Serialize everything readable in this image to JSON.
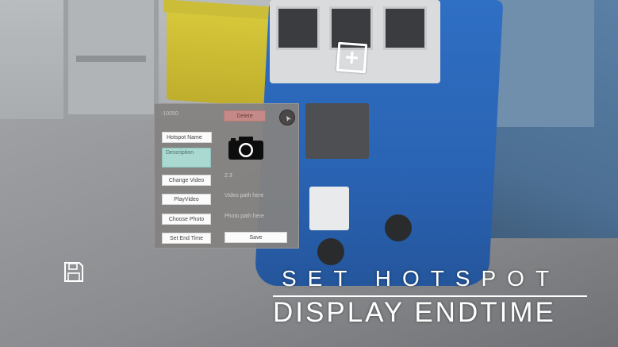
{
  "panel": {
    "id_text": "-10050",
    "delete_label": "Delete",
    "hotspot_name_label": "Hotspot Name",
    "description_label": "Description",
    "change_video_label": "Change Video",
    "play_video_label": "PlayVideo",
    "choose_photo_label": "Choose Photo",
    "set_end_time_label": "Set End Time",
    "save_label": "Save",
    "duration_text": "2.3",
    "video_path_text": "Video path here",
    "photo_path_text": "Photo path here"
  },
  "icons": {
    "close": "close-icon",
    "camera": "camera-icon",
    "crosshair": "crosshair-icon",
    "save": "floppy-disk-icon"
  },
  "caption": {
    "line1": "SET HOTSPOT",
    "line2": "DISPLAY ENDTIME"
  },
  "colors": {
    "panel_bg": "#84827f",
    "delete_bg": "#c58a87",
    "description_bg": "#a9d9d1",
    "button_bg": "#fbfbfb",
    "caption": "#ffffff"
  }
}
